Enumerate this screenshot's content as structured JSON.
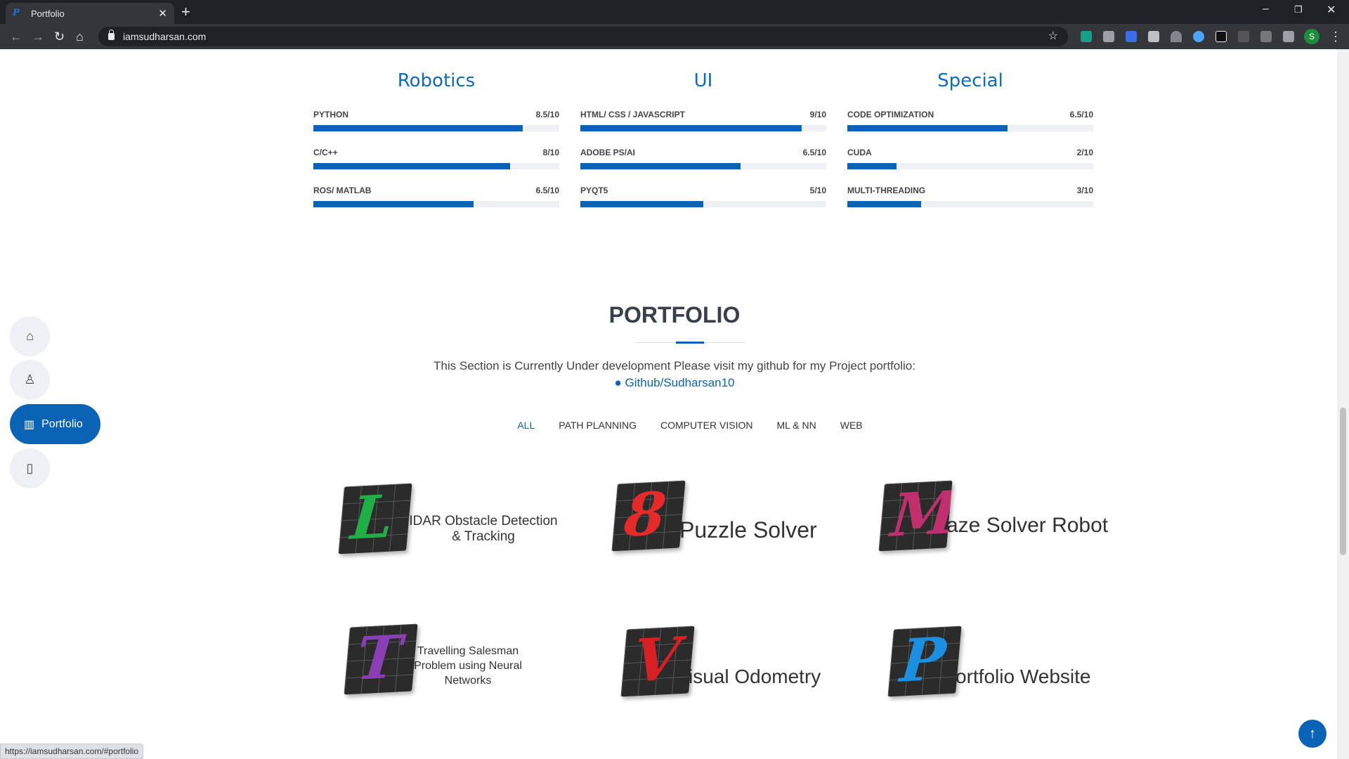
{
  "browser": {
    "tab_title": "Portfolio",
    "url": "iamsudharsan.com",
    "profile_initial": "S",
    "status_url": "https://iamsudharsan.com/#portfolio"
  },
  "skills": [
    {
      "title": "Robotics",
      "items": [
        {
          "name": "PYTHON",
          "score": "8.5/10",
          "value": 0.85
        },
        {
          "name": "C/C++",
          "score": "8/10",
          "value": 0.8
        },
        {
          "name": "ROS/ MATLAB",
          "score": "6.5/10",
          "value": 0.65
        }
      ]
    },
    {
      "title": "UI",
      "items": [
        {
          "name": "HTML/ CSS / JAVASCRIPT",
          "score": "9/10",
          "value": 0.9
        },
        {
          "name": "ADOBE PS/AI",
          "score": "6.5/10",
          "value": 0.65
        },
        {
          "name": "PYQT5",
          "score": "5/10",
          "value": 0.5
        }
      ]
    },
    {
      "title": "Special",
      "items": [
        {
          "name": "CODE OPTIMIZATION",
          "score": "6.5/10",
          "value": 0.65
        },
        {
          "name": "CUDA",
          "score": "2/10",
          "value": 0.2
        },
        {
          "name": "MULTI-THREADING",
          "score": "3/10",
          "value": 0.3
        }
      ]
    }
  ],
  "portfolio": {
    "title": "PORTFOLIO",
    "description": "This Section is Currently Under development Please visit my github for my Project portfolio:",
    "github_link": "Github/Sudharsan10",
    "filters": [
      "ALL",
      "PATH PLANNING",
      "COMPUTER VISION",
      "ML & NN",
      "WEB"
    ],
    "active_filter": "ALL",
    "projects": [
      {
        "letter": "L",
        "rest": "IDAR Obstacle Detection & Tracking",
        "color": "#1fae48"
      },
      {
        "letter": "8",
        "rest": "Puzzle Solver",
        "color": "#e52a2a"
      },
      {
        "letter": "M",
        "rest": "aze Solver Robot",
        "color": "#c0306e"
      },
      {
        "letter": "T",
        "rest": "Travelling Salesman Problem using Neural Networks",
        "color": "#8a3fb5"
      },
      {
        "letter": "V",
        "rest": "isual Odometry",
        "color": "#d71f26"
      },
      {
        "letter": "P",
        "rest": "ortfolio Website",
        "color": "#1c8fe0"
      }
    ]
  },
  "sidebar": {
    "home_icon": "home-icon",
    "about_icon": "user-icon",
    "portfolio_label": "Portfolio",
    "resume_icon": "file-icon"
  }
}
